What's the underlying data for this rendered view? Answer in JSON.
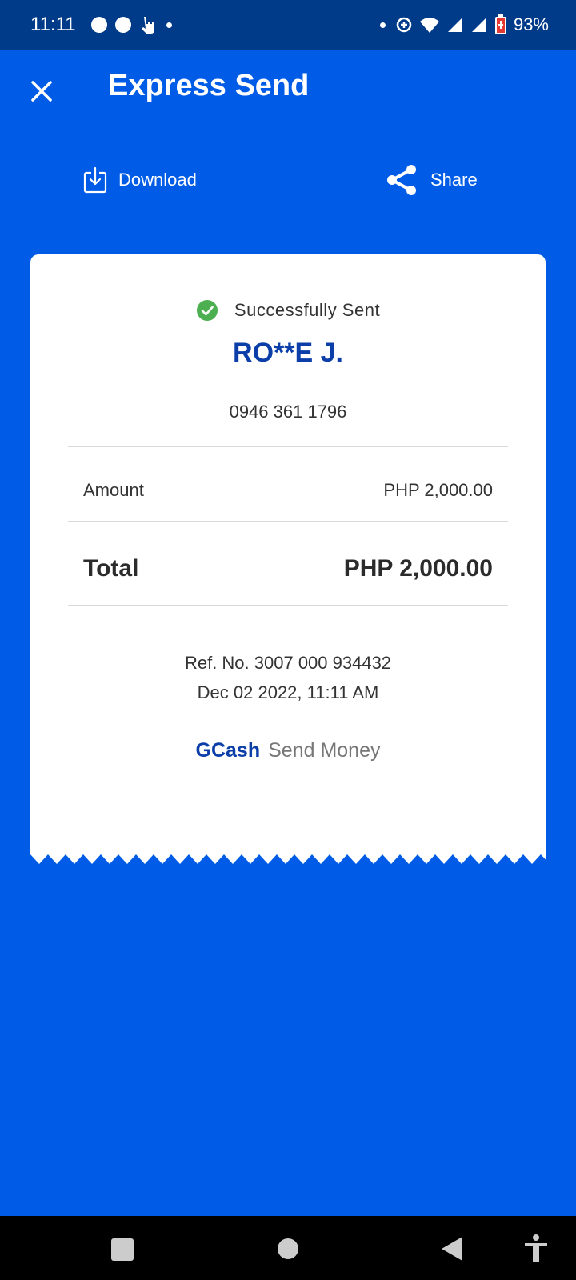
{
  "status_bar": {
    "time": "11:11",
    "battery_percent": "93%"
  },
  "app_bar": {
    "title": "Express Send",
    "close_icon": "close-icon"
  },
  "actions": {
    "download_label": "Download",
    "share_label": "Share"
  },
  "receipt": {
    "status_text": "Successfully Sent",
    "recipient_name": "RO**E J.",
    "recipient_phone": "0946 361 1796",
    "amount_label": "Amount",
    "amount_value": "PHP 2,000.00",
    "total_label": "Total",
    "total_value": "PHP 2,000.00",
    "reference": "Ref. No. 3007 000 934432",
    "datetime": "Dec 02 2022, 11:11 AM",
    "brand_name": "GCash",
    "brand_service": "Send Money"
  },
  "colors": {
    "background": "#005ce6",
    "status_bar": "#003b8a",
    "accent_text": "#0b3ea8",
    "success": "#4caf50"
  }
}
